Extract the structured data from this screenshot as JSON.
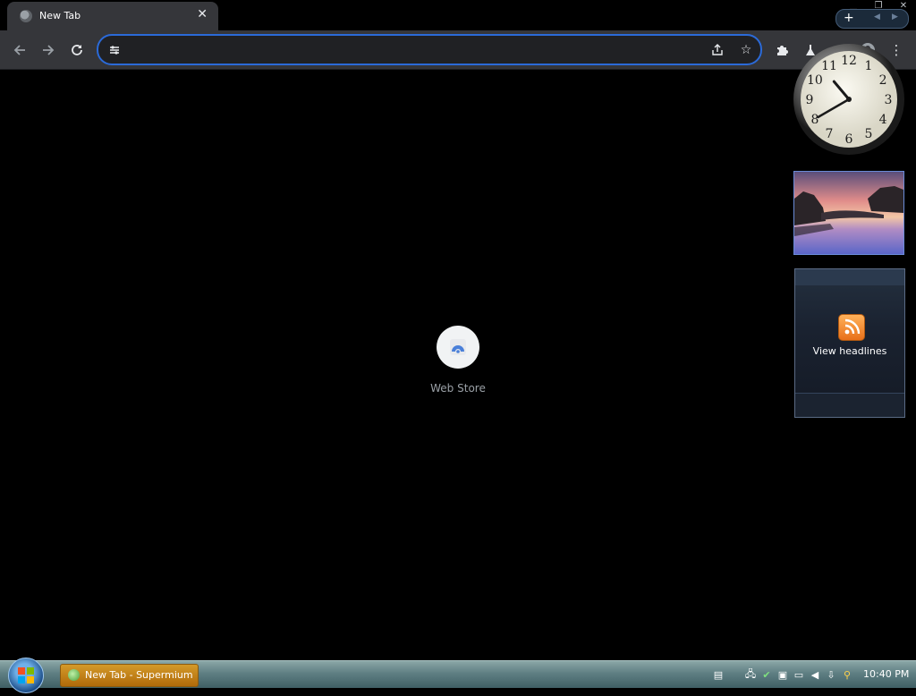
{
  "browser": {
    "tab": {
      "title": "New Tab",
      "close": "✕"
    },
    "window_controls": {
      "minimize": "▁",
      "maximize": "❐",
      "close": "✕"
    },
    "omnibox": {
      "value": "",
      "placeholder": ""
    }
  },
  "clock": {
    "hours": 10,
    "minutes": 40,
    "numerals": [
      "12",
      "1",
      "2",
      "3",
      "4",
      "5",
      "6",
      "7",
      "8",
      "9",
      "10",
      "11"
    ]
  },
  "sidebar": {
    "news_gadget": {
      "label": "View headlines"
    }
  },
  "newtab": {
    "shortcuts": [
      {
        "label": "Web Store"
      }
    ]
  },
  "taskbar": {
    "task": {
      "label": "New Tab - Supermium"
    },
    "time": "10:40 PM"
  },
  "colors": {
    "accent": "#2b6ad8",
    "toolbar": "#35363a",
    "background": "#000000"
  }
}
